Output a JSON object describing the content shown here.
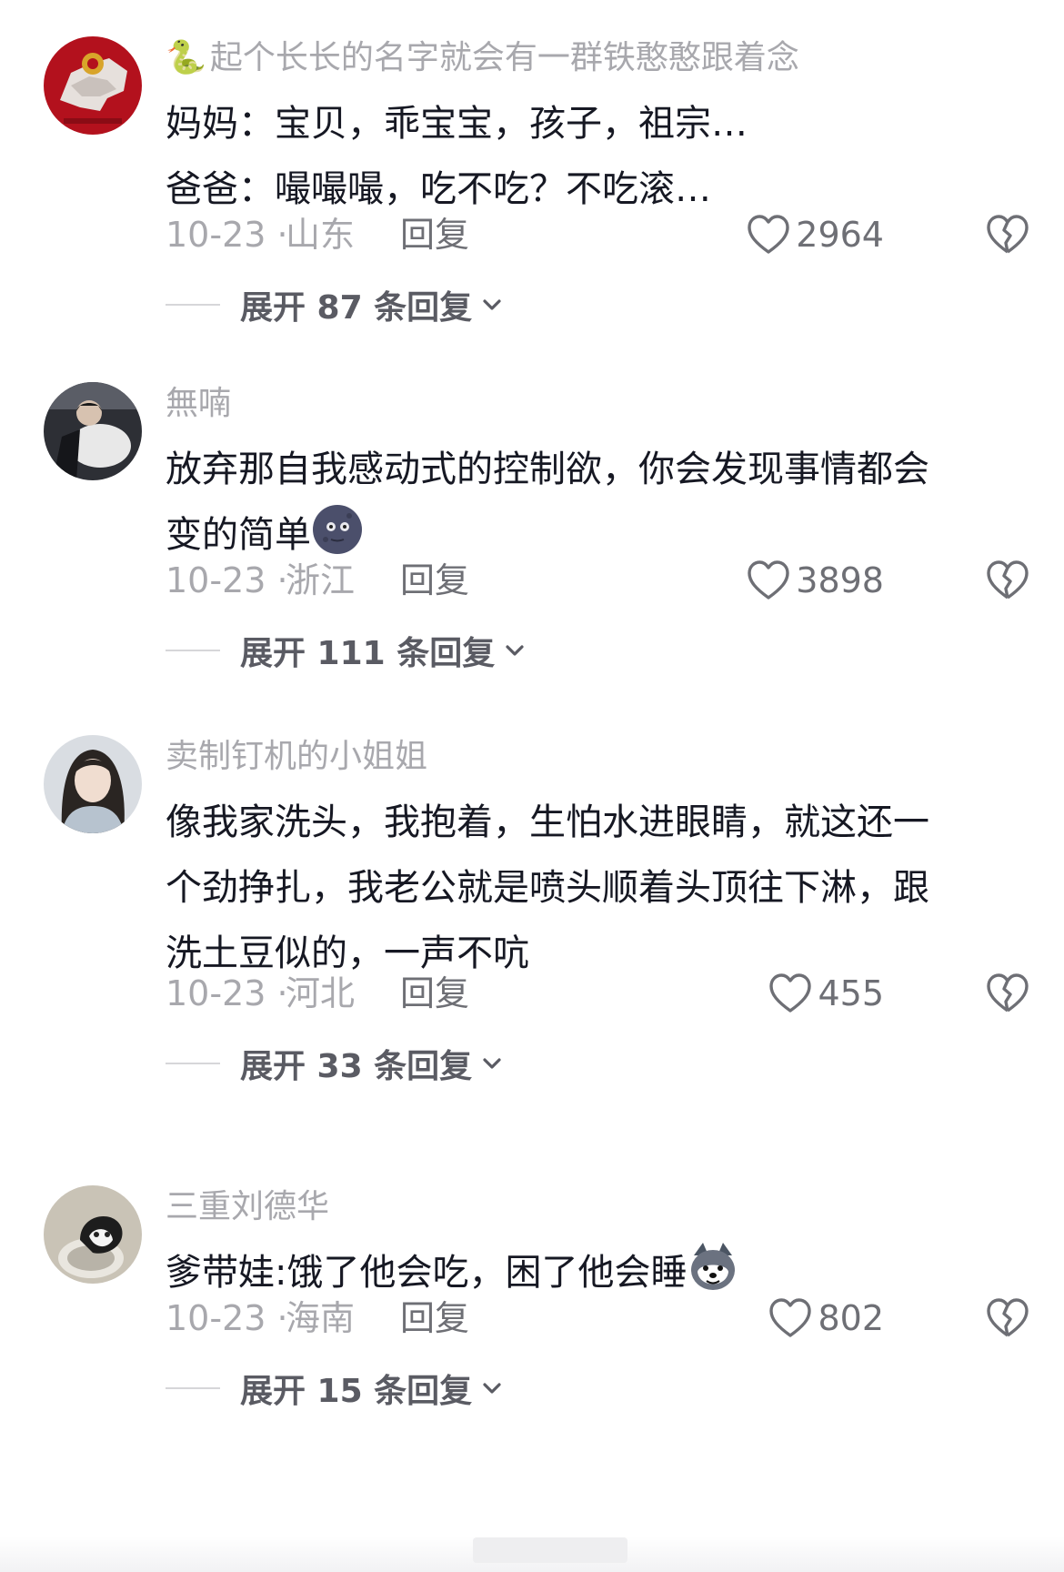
{
  "comments": [
    {
      "username_prefix": "🐍",
      "username": "起个长长的名字就会有一群铁憨憨跟着念",
      "lines": [
        "妈妈：宝贝，乖宝宝，孩子，祖宗…",
        "爸爸：嘬嘬嘬，吃不吃？不吃滚…"
      ],
      "date": "10-23 ·",
      "location": "山东",
      "reply_label": "回复",
      "likes": "2964",
      "expand_label": "展开 87 条回复"
    },
    {
      "username": "無喃",
      "lines": [
        "放弃那自我感动式的控制欲，你会发现事情都会",
        "变的简单"
      ],
      "trailing_emoji": "moon-face-emoji",
      "date": "10-23 ·",
      "location": "浙江",
      "reply_label": "回复",
      "likes": "3898",
      "expand_label": "展开 111 条回复"
    },
    {
      "username": "卖制钉机的小姐姐",
      "lines": [
        "像我家洗头，我抱着，生怕水进眼睛，就这还一",
        "个劲挣扎，我老公就是喷头顺着头顶往下淋，跟",
        "洗土豆似的，一声不吭"
      ],
      "date": "10-23 ·",
      "location": "河北",
      "reply_label": "回复",
      "likes": "455",
      "expand_label": "展开 33 条回复"
    },
    {
      "username": "三重刘德华",
      "lines": [
        "爹带娃:饿了他会吃，困了他会睡"
      ],
      "trailing_emoji": "husky-emoji",
      "date": "10-23 ·",
      "location": "海南",
      "reply_label": "回复",
      "likes": "802",
      "expand_label": "展开 15 条回复"
    }
  ],
  "icons": {
    "like": "heart-outline-icon",
    "dislike": "broken-heart-icon",
    "expand": "chevron-down-icon"
  },
  "colors": {
    "secondary_text": "#a8a8ad",
    "primary_text": "#161823",
    "action_text": "#6e6f75"
  }
}
